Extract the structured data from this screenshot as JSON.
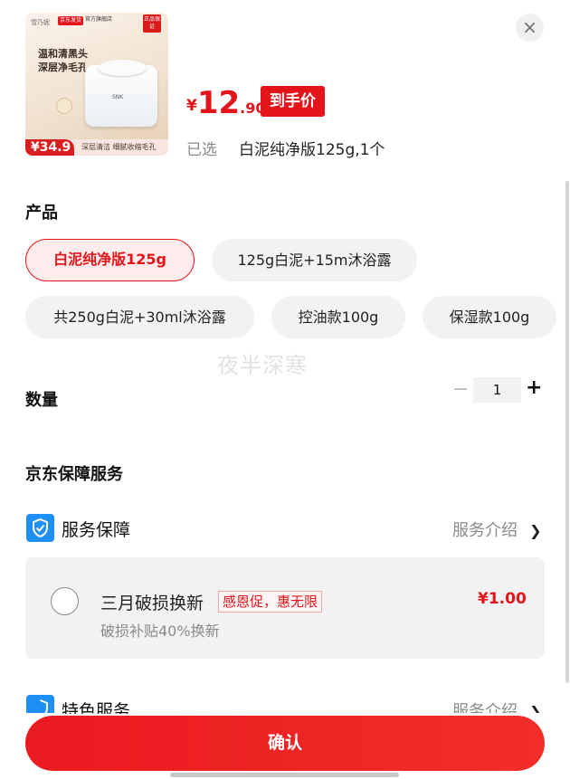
{
  "product": {
    "image": {
      "brand_text": "雪乃妮",
      "store_tag": "京东发货",
      "store_text": "官方旗舰店",
      "auth_badge": "正品保证",
      "headline_line1": "温和清黑头",
      "headline_line2": "深层净毛孔",
      "jar_label": "SNK",
      "price_chip": "¥34.9",
      "bottom_text": "深层清洁 细腻收缩毛孔"
    },
    "price": {
      "currency": "¥",
      "integer": "12",
      "decimal": ".90",
      "tag": "到手价"
    },
    "selected_label": "已选",
    "selected_value": "白泥纯净版125g,1个"
  },
  "close_icon": "×",
  "options": {
    "title": "产品",
    "items": [
      {
        "label": "白泥纯净版125g",
        "selected": true
      },
      {
        "label": "125g白泥+15m沐浴露",
        "selected": false
      },
      {
        "label": "共250g白泥+30ml沐浴露",
        "selected": false
      },
      {
        "label": "控油款100g",
        "selected": false
      },
      {
        "label": "保湿款100g",
        "selected": false
      }
    ]
  },
  "watermark": "夜半深寒",
  "quantity": {
    "title": "数量",
    "minus": "−",
    "value": "1",
    "plus": "+"
  },
  "services": {
    "title": "京东保障服务",
    "group1": {
      "label": "服务保障",
      "link": "服务介绍",
      "chevron": "❯"
    },
    "item": {
      "name": "三月破损换新",
      "promo": "感恩促，惠无限",
      "desc": "破损补贴40%换新",
      "price": "¥1.00"
    },
    "group2": {
      "label": "特色服务",
      "link": "服务介绍",
      "chevron": "❯"
    }
  },
  "confirm_label": "确认",
  "colors": {
    "accent": "#e3141a",
    "shield": "#1e8ff3"
  }
}
